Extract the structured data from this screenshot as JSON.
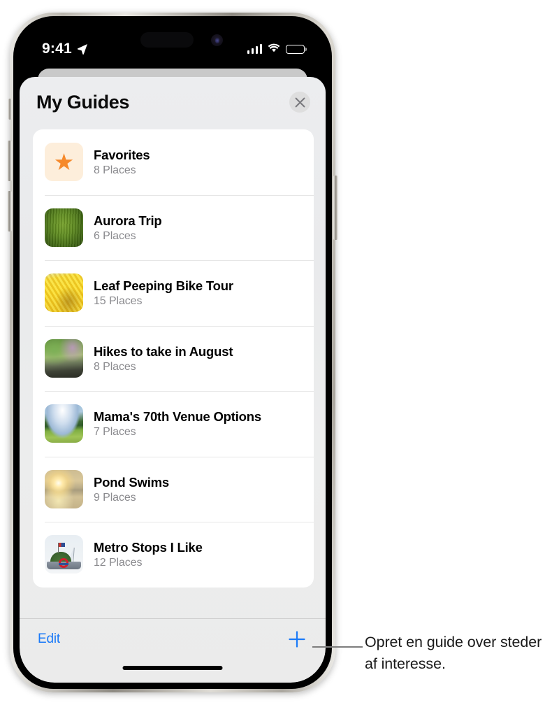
{
  "status_bar": {
    "time": "9:41",
    "location_arrow_icon": "location-arrow-icon",
    "cellular_icon": "cellular-signal-icon",
    "wifi_icon": "wifi-icon",
    "battery_icon": "battery-full-icon"
  },
  "sheet": {
    "title": "My Guides",
    "close_icon": "close-x-icon"
  },
  "guides": [
    {
      "title": "Favorites",
      "places": "8 Places",
      "thumb": "star-icon",
      "thumb_class": "thumb-fav"
    },
    {
      "title": "Aurora Trip",
      "places": "6 Places",
      "thumb": "green-field-photo",
      "thumb_class": "thumb-aurora"
    },
    {
      "title": "Leaf Peeping Bike Tour",
      "places": "15 Places",
      "thumb": "yellow-leaves-photo",
      "thumb_class": "thumb-leaf"
    },
    {
      "title": "Hikes to take in August",
      "places": "8 Places",
      "thumb": "forest-trail-photo",
      "thumb_class": "thumb-hikes"
    },
    {
      "title": "Mama's 70th Venue Options",
      "places": "7 Places",
      "thumb": "meadow-sky-photo",
      "thumb_class": "thumb-mama"
    },
    {
      "title": "Pond Swims",
      "places": "9 Places",
      "thumb": "sunset-lake-photo",
      "thumb_class": "thumb-pond"
    },
    {
      "title": "Metro Stops I Like",
      "places": "12 Places",
      "thumb": "metro-monument-photo",
      "thumb_class": "thumb-metro"
    }
  ],
  "toolbar": {
    "edit_label": "Edit",
    "add_icon": "plus-icon"
  },
  "callout": {
    "text": "Opret en guide over steder af interesse."
  },
  "colors": {
    "accent_blue": "#1a7af8",
    "star_orange": "#f6892a",
    "subtitle_gray": "#8a8a8e",
    "sheet_bg": "#ebecee",
    "card_bg": "#ffffff"
  }
}
